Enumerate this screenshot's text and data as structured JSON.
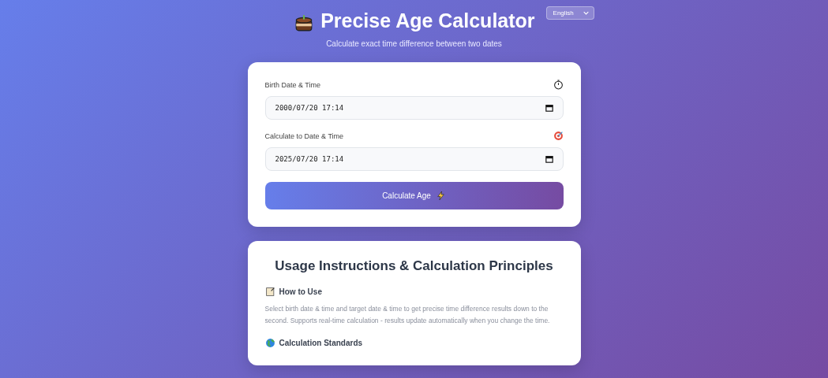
{
  "header": {
    "title": "Precise Age Calculator",
    "language": "English",
    "subtitle": "Calculate exact time difference between two dates"
  },
  "form": {
    "fields": [
      {
        "label": "Birth Date & Time",
        "value": "2000/07/20 17:14"
      },
      {
        "label": "Calculate to Date & Time",
        "value": "2025/07/20 17:14"
      }
    ],
    "button": "Calculate Age"
  },
  "instructions": {
    "title": "Usage Instructions & Calculation Principles",
    "sections": [
      {
        "heading": "How to Use",
        "text": "Select birth date & time and target date & time to get precise time difference results down to the second. Supports real-time calculation - results update automatically when you change the time."
      },
      {
        "heading": "Calculation Standards"
      }
    ]
  }
}
